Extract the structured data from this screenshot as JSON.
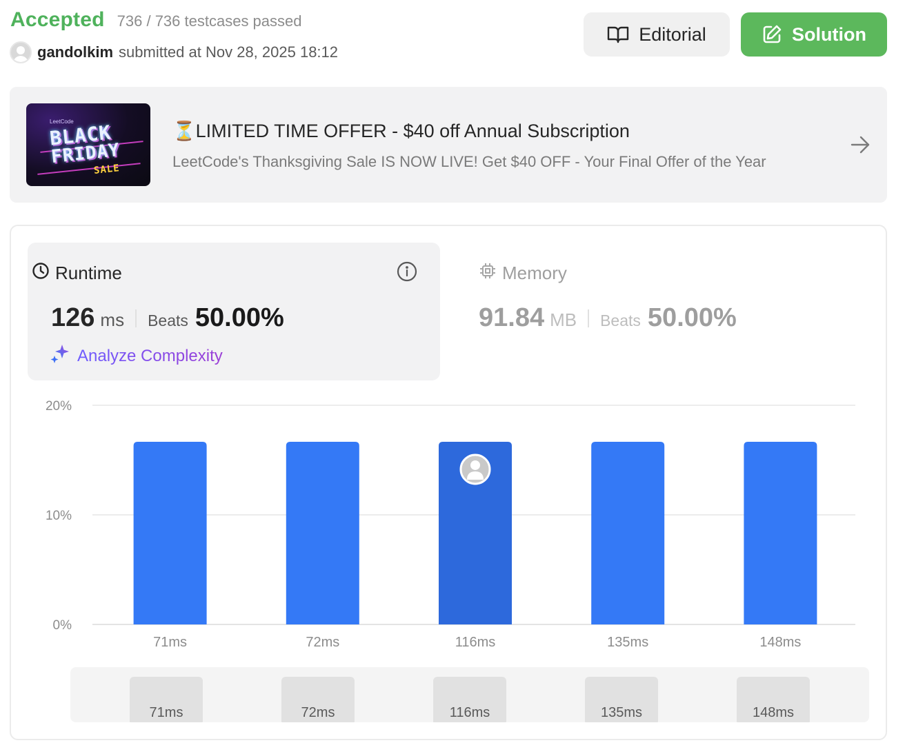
{
  "header": {
    "status": "Accepted",
    "testcases": "736 / 736 testcases passed",
    "username": "gandolkim",
    "submitted_text": "submitted at Nov 28, 2025 18:12",
    "editorial_label": "Editorial",
    "solution_label": "Solution",
    "accent_green": "#5cb85c"
  },
  "banner": {
    "image_lines": [
      "LeetCode",
      "BLACK",
      "FRIDAY",
      "SALE"
    ],
    "title_icon": "⏳",
    "title": "LIMITED TIME OFFER - $40 off Annual Subscription",
    "subtitle": "LeetCode's Thanksgiving Sale IS NOW LIVE! Get $40 OFF - Your Final Offer of the Year"
  },
  "runtime": {
    "label": "Runtime",
    "value": "126",
    "unit": "ms",
    "beats_label": "Beats",
    "beats": "50.00%",
    "analyze_label": "Analyze Complexity"
  },
  "memory": {
    "label": "Memory",
    "value": "91.84",
    "unit": "MB",
    "beats_label": "Beats",
    "beats": "50.00%"
  },
  "chart_data": {
    "type": "bar",
    "categories": [
      "71ms",
      "72ms",
      "116ms",
      "135ms",
      "148ms"
    ],
    "values": [
      16.67,
      16.67,
      16.67,
      16.67,
      16.67
    ],
    "y_ticks": [
      "0%",
      "10%",
      "20%"
    ],
    "ylim": [
      0,
      20
    ],
    "highlight_index": 2,
    "bar_color": "#3479f6",
    "highlight_color": "#2d69dc",
    "grid": true
  },
  "navigator": {
    "items": [
      "71ms",
      "72ms",
      "116ms",
      "135ms",
      "148ms"
    ]
  }
}
